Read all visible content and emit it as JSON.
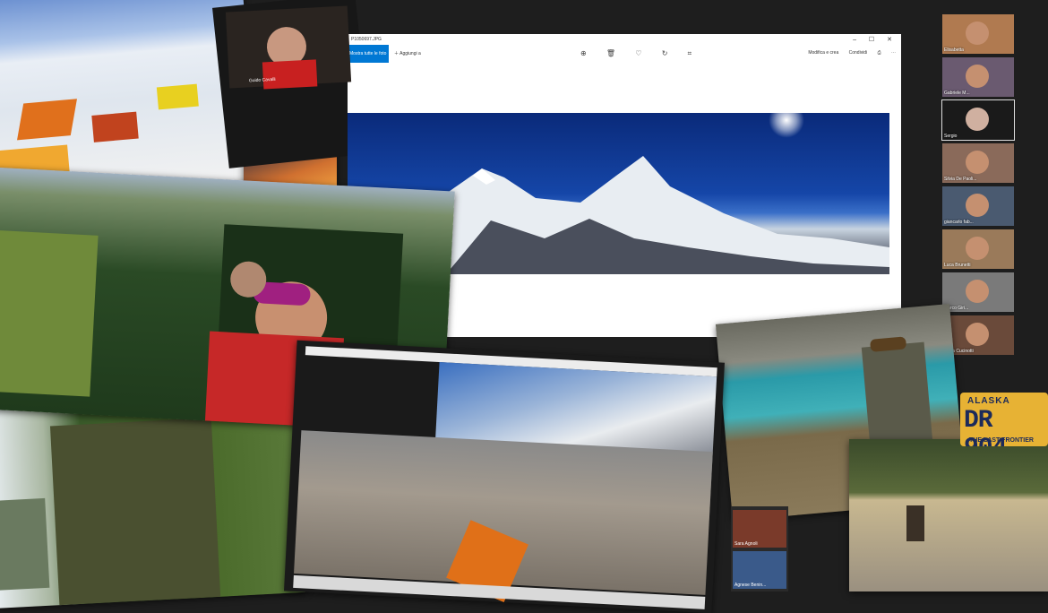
{
  "viewer": {
    "filename": "P1050697.JPG",
    "see_all_label": "Mostra tutte le foto",
    "add_label": "Aggiungi a",
    "edit_label": "Modifica e crea",
    "share_label": "Condividi",
    "window_controls": "– ☐ ✕",
    "toolbar_icons": "⊕ 🗑 ♡ ↻ ⌗"
  },
  "gallery": [
    {
      "name": "Elisabetta"
    },
    {
      "name": "Gabriele M..."
    },
    {
      "name": "Sergio"
    },
    {
      "name": "Silvia De Paoli..."
    },
    {
      "name": "giancarlo fab..."
    },
    {
      "name": "Luca Brunetti"
    },
    {
      "name": "Marco Giri..."
    },
    {
      "name": "Lucia Cucinotti"
    }
  ],
  "cam_label": "Guido Cavalli",
  "plate": {
    "state": "ALASKA",
    "number": "DR 904",
    "motto": "THE LAST FRONTIER"
  },
  "bottom_tiles": [
    {
      "name": "Sara Agnoli"
    },
    {
      "name": "Agnese Benin..."
    }
  ],
  "colors": {
    "background": "#1e1e1e",
    "accent": "#0078d4",
    "plate": "#e7b234"
  }
}
